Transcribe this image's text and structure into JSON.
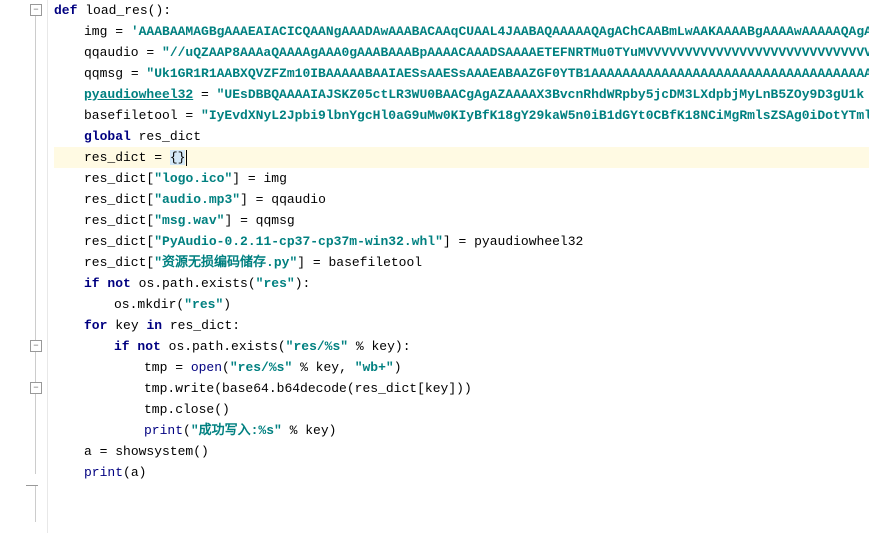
{
  "code": {
    "func_def": "load_res",
    "kw_def": "def",
    "kw_global": "global",
    "kw_if": "if",
    "kw_not": "not",
    "kw_for": "for",
    "kw_in": "in",
    "var_img": "img",
    "var_qqaudio": "qqaudio",
    "var_qqmsg": "qqmsg",
    "var_pyaudiowheel32": "pyaudiowheel32",
    "var_basefiletool": "basefiletool",
    "var_res_dict": "res_dict",
    "var_key": "key",
    "var_tmp": "tmp",
    "var_a": "a",
    "str_img": "'AAABAAMAGBgAAAEAIACICQAANgAAADAwAAABACAAqCUAAL4JAABAQAAAAAQAgAChCAABmLwAAKAAAABgAAAAwAAAAAQAgA",
    "str_qqaudio": "\"//uQZAAP8AAAaQAAAAgAAA0gAAABAAABpAAAACAAADSAAAAETEFNRTMu0TYuMVVVVVVVVVVVVVVVVVVVVVVVVVVVVV",
    "str_qqmsg": "\"Uk1GR1R1AABXQVZFZm10IBAAAAABAAIAESsAAESsAAAEABAAZGF0YTB1AAAAAAAAAAAAAAAAAAAAAAAAAAAAAAAAAAAAAAAA",
    "str_pyaudiowheel32": "\"UEsDBBQAAAAIAJSKZ05ctLR3WU0BAACgAgAZAAAAX3BvcnRhdWRpby5jcDM3LXdpbjMyLnB5ZOy9D3gU1k",
    "str_basefiletool": "\"IyEvdXNyL2Jpbi9lbnYgcHl0aG9uMw0KIyBfK18gY29kaW5n0iB1dGYt0CBfK18NCiMgRmlsZSAg0iDotYTml",
    "str_logo": "\"logo.ico\"",
    "str_audio": "\"audio.mp3\"",
    "str_msg": "\"msg.wav\"",
    "str_whl": "\"PyAudio-0.2.11-cp37-cp37m-win32.whl\"",
    "str_baseutil": "\"资源无损编码储存.py\"",
    "str_res": "\"res\"",
    "str_res_pct": "\"res/%s\"",
    "str_wb": "\"wb+\"",
    "str_success": "\"成功写入:%s\"",
    "empty_dict": "{}",
    "eq": " = ",
    "paren_open": "(",
    "paren_close": ")",
    "colon": ":",
    "bracket_open": "[",
    "bracket_close": "]",
    "os_path_exists": "os.path.exists",
    "os_mkdir": "os.mkdir",
    "open": "open",
    "tmp_write": "tmp.write",
    "tmp_close": "tmp.close",
    "print": "print",
    "b64decode": "base64.b64decode",
    "showsystem": "showsystem",
    "pct_key": " % key",
    "comma_sp": ", "
  }
}
